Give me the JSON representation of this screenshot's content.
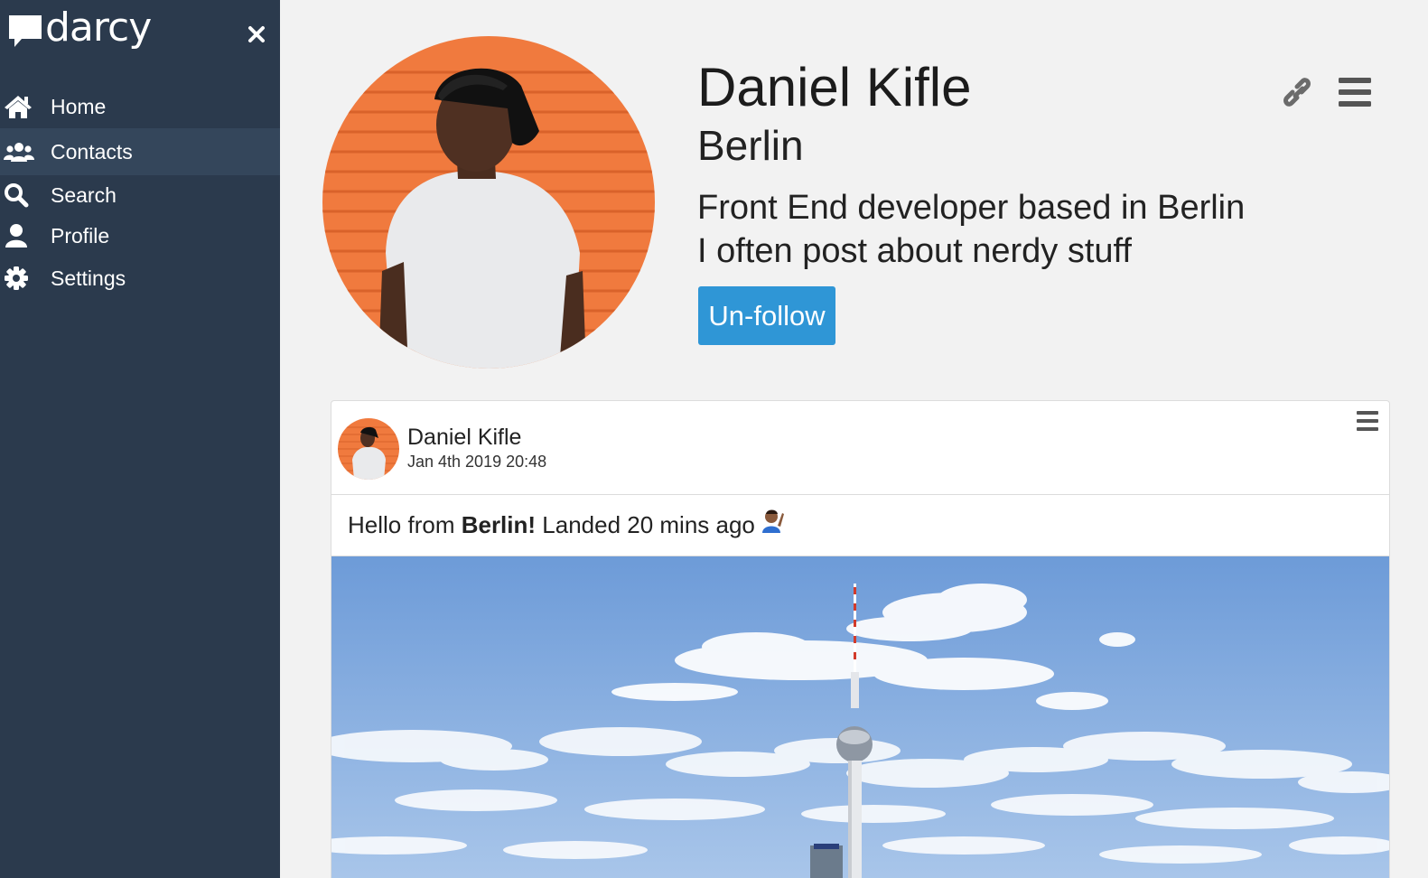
{
  "app": {
    "brand": "darcy"
  },
  "sidebar": {
    "items": [
      {
        "label": "Home",
        "icon": "home-icon",
        "active": false
      },
      {
        "label": "Contacts",
        "icon": "contacts-icon",
        "active": true
      },
      {
        "label": "Search",
        "icon": "search-icon",
        "active": false
      },
      {
        "label": "Profile",
        "icon": "profile-icon",
        "active": false
      },
      {
        "label": "Settings",
        "icon": "settings-icon",
        "active": false
      }
    ]
  },
  "profile": {
    "name": "Daniel Kifle",
    "city": "Berlin",
    "bio_line1": "Front End developer based in Berlin",
    "bio_line2": "I often post about nerdy stuff",
    "follow_button": "Un-follow"
  },
  "post": {
    "author": "Daniel Kifle",
    "timestamp": "Jan 4th 2019 20:48",
    "text_before": "Hello from ",
    "text_bold": "Berlin!",
    "text_after": " Landed 20 mins ago",
    "emoji": "raising-hand-emoji"
  },
  "colors": {
    "sidebar_bg": "#2b3a4d",
    "sidebar_active": "#34465b",
    "accent": "#2f96d6",
    "page_bg": "#f2f2f2",
    "avatar_bg": "#f07a3e"
  }
}
